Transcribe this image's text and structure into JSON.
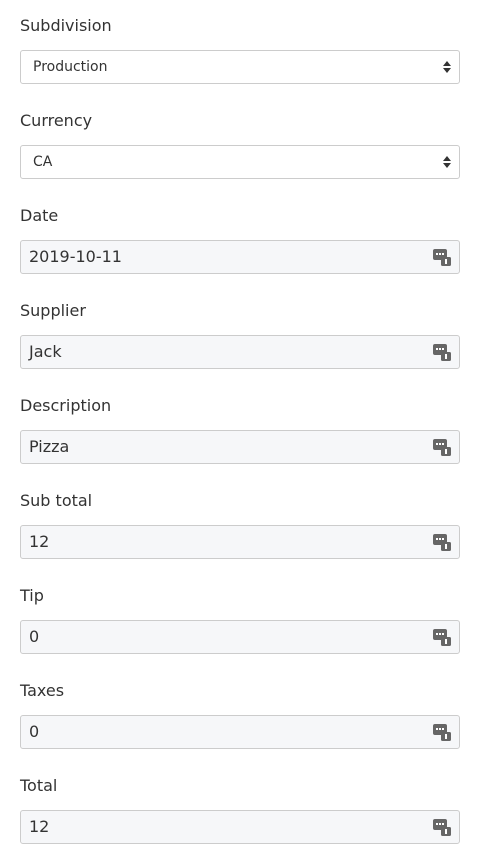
{
  "fields": [
    {
      "label": "Subdivision",
      "value": "Production",
      "type": "select"
    },
    {
      "label": "Currency",
      "value": "CA",
      "type": "select"
    },
    {
      "label": "Date",
      "value": "2019-10-11",
      "type": "input"
    },
    {
      "label": "Supplier",
      "value": "Jack",
      "type": "input"
    },
    {
      "label": "Description",
      "value": "Pizza",
      "type": "input"
    },
    {
      "label": "Sub total",
      "value": "12",
      "type": "input"
    },
    {
      "label": "Tip",
      "value": "0",
      "type": "input"
    },
    {
      "label": "Taxes",
      "value": "0",
      "type": "input"
    },
    {
      "label": "Total",
      "value": "12",
      "type": "input"
    }
  ],
  "icons": {
    "select": "sort-icon",
    "input": "keyboard-icon"
  },
  "colors": {
    "input_background": "#f6f7f9",
    "border": "#cccccc",
    "text": "#333333",
    "icon": "#666666"
  }
}
